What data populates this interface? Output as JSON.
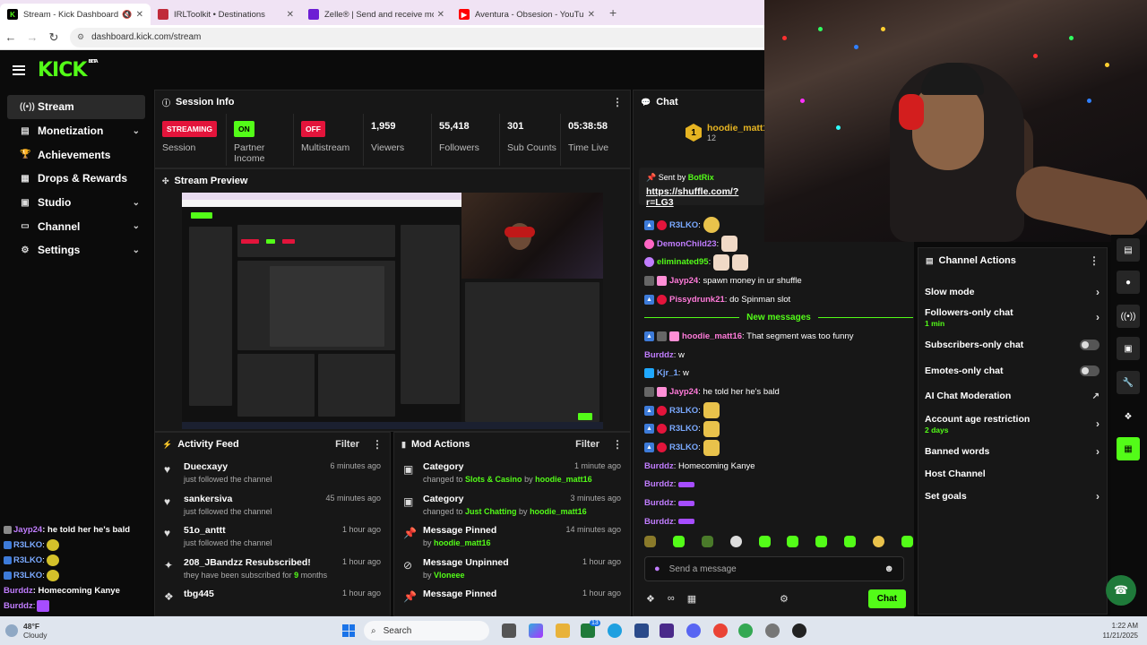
{
  "browser": {
    "tabs": [
      {
        "title": "Stream - Kick Dashboard",
        "active": true
      },
      {
        "title": "IRLToolkit • Destinations",
        "active": false
      },
      {
        "title": "Zelle® | Send and receive mone",
        "active": false
      },
      {
        "title": "Aventura - Obsesion - YouTu",
        "active": false
      }
    ],
    "url": "dashboard.kick.com/stream"
  },
  "brand": {
    "logo": "KICK",
    "beta": "BETA",
    "accent": "#53fc18"
  },
  "sidebar": {
    "items": [
      {
        "label": "Stream",
        "icon": "broadcast-icon"
      },
      {
        "label": "Monetization",
        "icon": "money-icon"
      },
      {
        "label": "Achievements",
        "icon": "trophy-icon"
      },
      {
        "label": "Drops & Rewards",
        "icon": "gift-icon"
      },
      {
        "label": "Studio",
        "icon": "studio-icon"
      },
      {
        "label": "Channel",
        "icon": "channel-icon"
      },
      {
        "label": "Settings",
        "icon": "gear-icon"
      }
    ]
  },
  "overlay_chat": [
    {
      "user": "Jayp24",
      "msg": " : he told her he's bald"
    },
    {
      "user": "R3LKO",
      "msg": " :"
    },
    {
      "user": "R3LKO",
      "msg": " :"
    },
    {
      "user": "R3LKO",
      "msg": " :"
    },
    {
      "user": "Burddz",
      "msg": " : Homecoming Kanye"
    },
    {
      "user": "Burddz",
      "msg": " :"
    }
  ],
  "session": {
    "title": "Session Info",
    "stats": [
      {
        "value": "STREAMING",
        "label": "Session",
        "kind": "pill-red"
      },
      {
        "value": "ON",
        "label": "Partner Income",
        "kind": "pill-green"
      },
      {
        "value": "OFF",
        "label": "Multistream",
        "kind": "pill-red"
      },
      {
        "value": "1,959",
        "label": "Viewers"
      },
      {
        "value": "55,418",
        "label": "Followers"
      },
      {
        "value": "301",
        "label": "Sub Counts"
      },
      {
        "value": "05:38:58",
        "label": "Time Live"
      }
    ]
  },
  "preview": {
    "title": "Stream Preview"
  },
  "activity": {
    "title": "Activity Feed",
    "filter": "Filter",
    "items": [
      {
        "title": "Duecxayy",
        "sub": "just followed the channel",
        "time": "6 minutes ago",
        "icon": "heart-icon"
      },
      {
        "title": "sankersiva",
        "sub": "just followed the channel",
        "time": "45 minutes ago",
        "icon": "heart-icon"
      },
      {
        "title": "51o_anttt",
        "sub": "just followed the channel",
        "time": "1 hour ago",
        "icon": "heart-icon"
      },
      {
        "title": "208_JBandzz Resubscribed!",
        "sub_pre": "they have been subscribed for ",
        "sub_hl": "9",
        "sub_post": " months",
        "time": "1 hour ago",
        "icon": "sparkle-icon"
      },
      {
        "title": "tbg445",
        "sub": "",
        "time": "1 hour ago",
        "icon": "kick-icon"
      }
    ]
  },
  "mod_actions": {
    "title": "Mod Actions",
    "filter": "Filter",
    "items": [
      {
        "title": "Category",
        "pre": "changed to ",
        "hl": "Slots & Casino",
        "mid": " by ",
        "user": "hoodie_matt16",
        "time": "1 minute ago",
        "icon": "category-icon"
      },
      {
        "title": "Category",
        "pre": "changed to ",
        "hl": "Just Chatting",
        "mid": " by ",
        "user": "hoodie_matt16",
        "time": "3 minutes ago",
        "icon": "category-icon"
      },
      {
        "title": "Message Pinned",
        "pre": "by ",
        "hl": "",
        "mid": "",
        "user": "hoodie_matt16",
        "time": "14 minutes ago",
        "icon": "pin-icon"
      },
      {
        "title": "Message Unpinned",
        "pre": "by ",
        "hl": "",
        "mid": "",
        "user": "Vloneee",
        "time": "1 hour ago",
        "icon": "unpin-icon"
      },
      {
        "title": "Message Pinned",
        "pre": "",
        "hl": "",
        "mid": "",
        "user": "",
        "time": "1 hour ago",
        "icon": "pin-icon"
      }
    ]
  },
  "chat": {
    "title": "Chat",
    "top_gifter": {
      "rank": "1",
      "user": "hoodie_matt16",
      "count": "12"
    },
    "pinned": {
      "sent_by": "Sent by",
      "bot": "BotRix",
      "link": "https://shuffle.com/?r=LG3"
    },
    "messages_before": [
      {
        "user": "R3LKO",
        "text": ":",
        "color": "blue"
      },
      {
        "user": "DemonChild23",
        "text": ":",
        "color": "purple"
      },
      {
        "user": "eliminated95",
        "text": ":",
        "color": "green"
      },
      {
        "user": "Jayp24",
        "text": ": spawn money in ur shuffle",
        "color": "pink"
      },
      {
        "user": "Pissydrunk21",
        "text": ": do Spinman slot",
        "color": "pink"
      }
    ],
    "new_messages_label": "New messages",
    "messages_after": [
      {
        "user": "hoodie_matt16",
        "text": ": That segment was too funny",
        "color": "pink"
      },
      {
        "user": "Burddz",
        "text": ": w",
        "color": "purple"
      },
      {
        "user": "Kjr_1",
        "text": ": w",
        "color": "blue"
      },
      {
        "user": "Jayp24",
        "text": ": he told her he's bald",
        "color": "pink"
      },
      {
        "user": "R3LKO",
        "text": ":",
        "color": "blue"
      },
      {
        "user": "R3LKO",
        "text": ":",
        "color": "blue"
      },
      {
        "user": "R3LKO",
        "text": ":",
        "color": "blue"
      },
      {
        "user": "Burddz",
        "text": ": Homecoming Kanye",
        "color": "purple"
      },
      {
        "user": "Burddz",
        "text": ":",
        "color": "purple"
      },
      {
        "user": "Burddz",
        "text": ":",
        "color": "purple"
      },
      {
        "user": "Burddz",
        "text": ":",
        "color": "purple"
      }
    ],
    "input_placeholder": "Send a message",
    "send_label": "Chat"
  },
  "channel_actions": {
    "title": "Channel Actions",
    "rows": [
      {
        "label": "Slow mode",
        "sub": "",
        "control": "chevron"
      },
      {
        "label": "Followers-only chat",
        "sub": "1 min",
        "control": "chevron"
      },
      {
        "label": "Subscribers-only chat",
        "sub": "",
        "control": "toggle"
      },
      {
        "label": "Emotes-only chat",
        "sub": "",
        "control": "toggle"
      },
      {
        "label": "AI Chat Moderation",
        "sub": "",
        "control": "external"
      },
      {
        "label": "Account age restriction",
        "sub": "2 days",
        "control": "chevron"
      },
      {
        "label": "Banned words",
        "sub": "",
        "control": "chevron"
      },
      {
        "label": "Host Channel",
        "sub": "",
        "control": "none"
      },
      {
        "label": "Set goals",
        "sub": "",
        "control": "chevron"
      }
    ]
  },
  "taskbar": {
    "weather_temp": "48°F",
    "weather_text": "Cloudy",
    "search": "Search",
    "time": "1:22 AM",
    "date": "11/21/2025",
    "badge_count": "13"
  }
}
